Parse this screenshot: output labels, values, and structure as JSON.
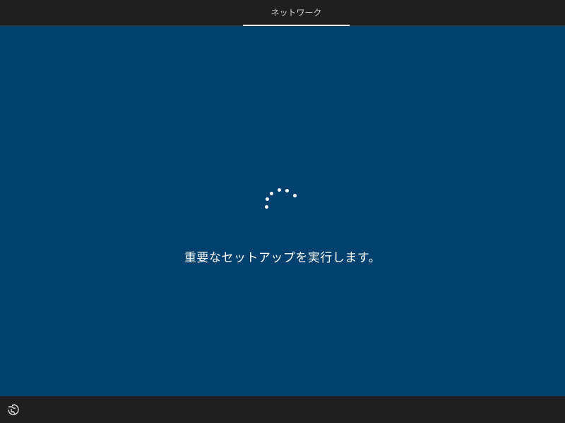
{
  "header": {
    "tabs": [
      {
        "label": "ネットワーク",
        "active": true
      }
    ]
  },
  "main": {
    "status_text": "重要なセットアップを実行します。",
    "spinner_icon": "loading-dots-icon"
  },
  "footer": {
    "accessibility_icon": "ease-of-access-icon"
  },
  "colors": {
    "background": "#00416f",
    "bars": "#1f1f1f",
    "text": "#ffffff",
    "tab_text": "#cfcfcf"
  }
}
